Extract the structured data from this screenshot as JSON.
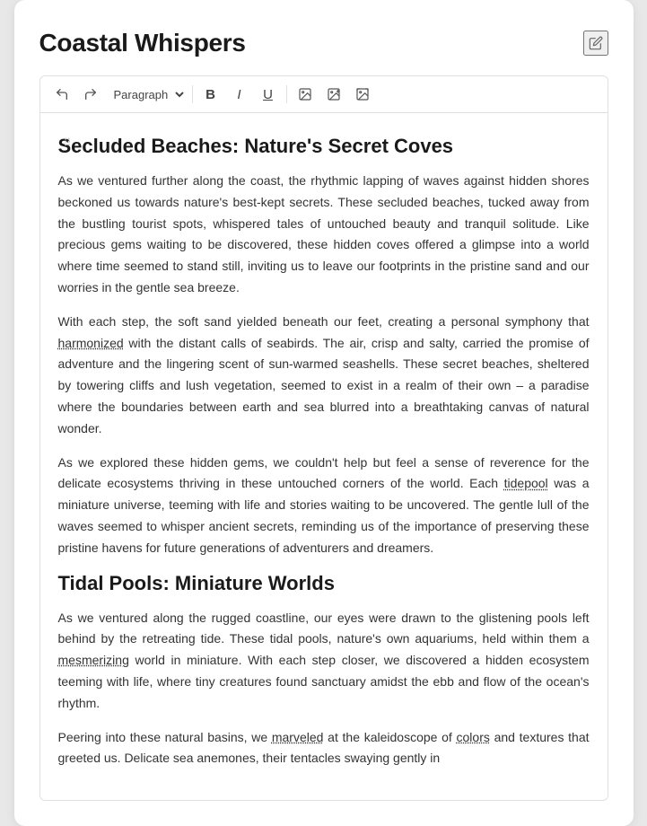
{
  "page": {
    "title": "Coastal Whispers",
    "edit_label": "edit"
  },
  "toolbar": {
    "undo_label": "↩",
    "redo_label": "↪",
    "paragraph_label": "Paragraph",
    "bold_label": "B",
    "italic_label": "I",
    "underline_label": "U",
    "image_label": "img",
    "image_plus_label": "img+",
    "image_frame_label": "imgf"
  },
  "content": {
    "heading1": "Secluded Beaches: Nature's Secret Coves",
    "para1": "As we ventured further along the coast, the rhythmic lapping of waves against hidden shores beckoned us towards nature's best-kept secrets. These secluded beaches, tucked away from the bustling tourist spots, whispered tales of untouched beauty and tranquil solitude. Like precious gems waiting to be discovered, these hidden coves offered a glimpse into a world where time seemed to stand still, inviting us to leave our footprints in the pristine sand and our worries in the gentle sea breeze.",
    "para2_before_harmonized": "With each step, the soft sand yielded beneath our feet, creating a personal symphony that ",
    "para2_harmonized": "harmonized",
    "para2_after_harmonized": " with the distant calls of seabirds. The air, crisp and salty, carried the promise of adventure and the lingering scent of sun-warmed seashells. These secret beaches, sheltered by towering cliffs and lush vegetation, seemed to exist in a realm of their own – a paradise where the boundaries between earth and sea blurred into a breathtaking canvas of natural wonder.",
    "para3_before_tidepool": "As we explored these hidden gems, we couldn't help but feel a sense of reverence for the delicate ecosystems thriving in these untouched corners of the world. Each ",
    "para3_tidepool": "tidepool",
    "para3_after_tidepool": " was a miniature universe, teeming with life and stories waiting to be uncovered. The gentle lull of the waves seemed to whisper ancient secrets, reminding us of the importance of preserving these pristine havens for future generations of adventurers and dreamers.",
    "heading2": "Tidal Pools: Miniature Worlds",
    "para4": "As we ventured along the rugged coastline, our eyes were drawn to the glistening pools left behind by the retreating tide. These tidal pools, nature's own aquariums, held within them a mesmerizing world in miniature. With each step closer, we discovered a hidden ecosystem teeming with life, where tiny creatures found sanctuary amidst the ebb and flow of the ocean's rhythm.",
    "para5_before_marveled": "Peering into these natural basins, we ",
    "para5_marveled": "marveled",
    "para5_after_marveled": " at the kaleidoscope of ",
    "para5_colors": "colors",
    "para5_end": " and textures that greeted us. Delicate sea anemones, their tentacles swaying gently in"
  }
}
